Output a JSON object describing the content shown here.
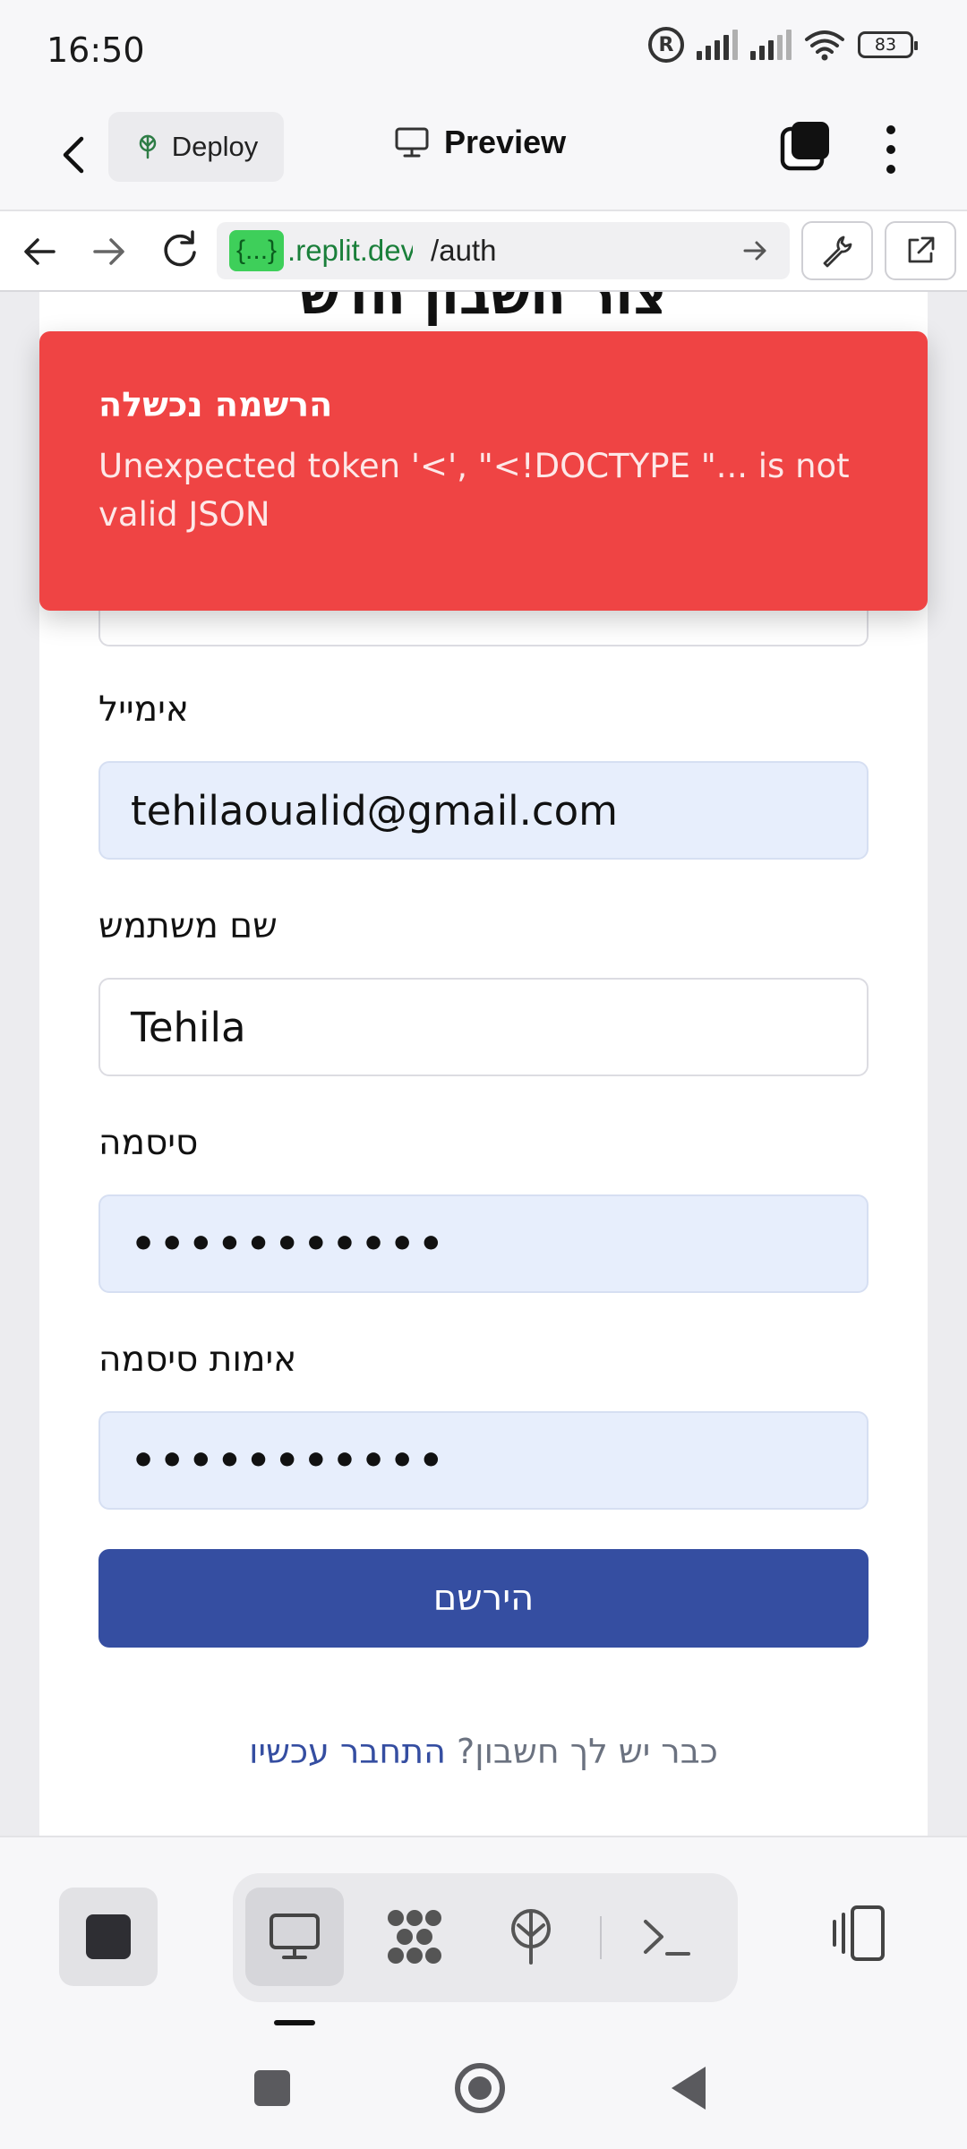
{
  "status_bar": {
    "time": "16:50",
    "battery": "83"
  },
  "header": {
    "deploy_label": "Deploy",
    "preview_label": "Preview"
  },
  "url_bar": {
    "badge": "{...}",
    "domain": ".replit.dev",
    "path": "/auth"
  },
  "form": {
    "title": "צור חשבון חדש",
    "email_label": "אימייל",
    "email_value": "tehilaoualid@gmail.com",
    "username_label": "שם משתמש",
    "username_value": "Tehila",
    "password_label": "סיסמה",
    "password_value": "•••••••••••",
    "confirm_label": "אימות סיסמה",
    "confirm_value": "•••••••••••",
    "submit_label": "הירשם",
    "login_prompt": "כבר יש לך חשבון?",
    "login_link": "התחבר עכשיו"
  },
  "toast": {
    "title": "הרשמה נכשלה",
    "message": "Unexpected token '<', \"<!DOCTYPE \"... is not valid JSON"
  },
  "colors": {
    "accent": "#354ea1",
    "error": "#ef4444",
    "url_badge": "#3ecf5a",
    "filled_input": "#e7eefc"
  }
}
